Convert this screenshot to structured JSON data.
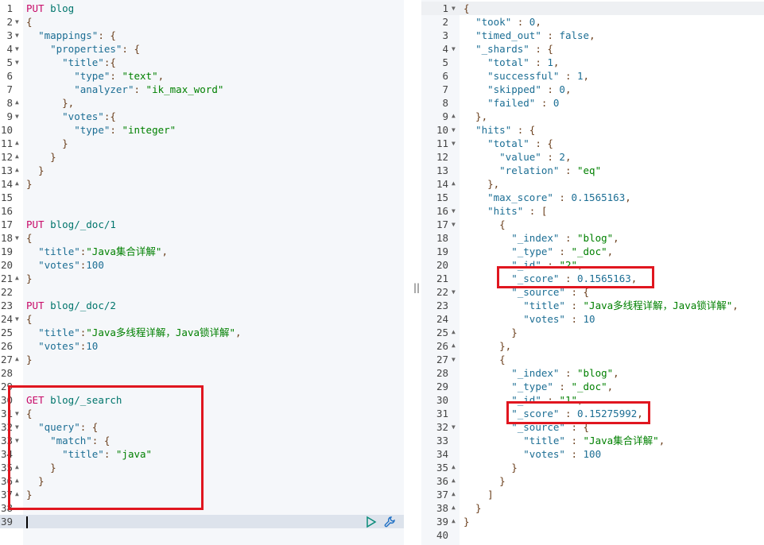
{
  "request_editor": {
    "active_line": 39,
    "actions": {
      "run": "play-icon",
      "settings": "wrench-icon"
    },
    "lines": [
      [
        "",
        [
          [
            "m",
            "PUT"
          ],
          [
            "p",
            " "
          ],
          [
            "u",
            "blog"
          ]
        ]
      ],
      [
        "open",
        [
          [
            "p",
            "{"
          ]
        ]
      ],
      [
        "open",
        [
          [
            "p",
            "  "
          ],
          [
            "k",
            "\"mappings\""
          ],
          [
            "p",
            ": {"
          ]
        ]
      ],
      [
        "open",
        [
          [
            "p",
            "    "
          ],
          [
            "k",
            "\"properties\""
          ],
          [
            "p",
            ": {"
          ]
        ]
      ],
      [
        "open",
        [
          [
            "p",
            "      "
          ],
          [
            "k",
            "\"title\""
          ],
          [
            "p",
            ":{"
          ]
        ]
      ],
      [
        "",
        [
          [
            "p",
            "        "
          ],
          [
            "k",
            "\"type\""
          ],
          [
            "p",
            ": "
          ],
          [
            "s",
            "\"text\""
          ],
          [
            "p",
            ","
          ]
        ]
      ],
      [
        "",
        [
          [
            "p",
            "        "
          ],
          [
            "k",
            "\"analyzer\""
          ],
          [
            "p",
            ": "
          ],
          [
            "s",
            "\"ik_max_word\""
          ]
        ]
      ],
      [
        "close",
        [
          [
            "p",
            "      },"
          ]
        ]
      ],
      [
        "open",
        [
          [
            "p",
            "      "
          ],
          [
            "k",
            "\"votes\""
          ],
          [
            "p",
            ":{"
          ]
        ]
      ],
      [
        "",
        [
          [
            "p",
            "        "
          ],
          [
            "k",
            "\"type\""
          ],
          [
            "p",
            ": "
          ],
          [
            "s",
            "\"integer\""
          ]
        ]
      ],
      [
        "close",
        [
          [
            "p",
            "      }"
          ]
        ]
      ],
      [
        "close",
        [
          [
            "p",
            "    }"
          ]
        ]
      ],
      [
        "close",
        [
          [
            "p",
            "  }"
          ]
        ]
      ],
      [
        "close",
        [
          [
            "p",
            "}"
          ]
        ]
      ],
      [
        "",
        []
      ],
      [
        "",
        []
      ],
      [
        "",
        [
          [
            "m",
            "PUT"
          ],
          [
            "p",
            " "
          ],
          [
            "u",
            "blog/_doc/1"
          ]
        ]
      ],
      [
        "open",
        [
          [
            "p",
            "{"
          ]
        ]
      ],
      [
        "",
        [
          [
            "p",
            "  "
          ],
          [
            "k",
            "\"title\""
          ],
          [
            "p",
            ":"
          ],
          [
            "s",
            "\"Java集合详解\""
          ],
          [
            "p",
            ","
          ]
        ]
      ],
      [
        "",
        [
          [
            "p",
            "  "
          ],
          [
            "k",
            "\"votes\""
          ],
          [
            "p",
            ":"
          ],
          [
            "n",
            "100"
          ]
        ]
      ],
      [
        "close",
        [
          [
            "p",
            "}"
          ]
        ]
      ],
      [
        "",
        []
      ],
      [
        "",
        [
          [
            "m",
            "PUT"
          ],
          [
            "p",
            " "
          ],
          [
            "u",
            "blog/_doc/2"
          ]
        ]
      ],
      [
        "open",
        [
          [
            "p",
            "{"
          ]
        ]
      ],
      [
        "",
        [
          [
            "p",
            "  "
          ],
          [
            "k",
            "\"title\""
          ],
          [
            "p",
            ":"
          ],
          [
            "s",
            "\"Java多线程详解，Java锁详解\""
          ],
          [
            "p",
            ","
          ]
        ]
      ],
      [
        "",
        [
          [
            "p",
            "  "
          ],
          [
            "k",
            "\"votes\""
          ],
          [
            "p",
            ":"
          ],
          [
            "n",
            "10"
          ]
        ]
      ],
      [
        "close",
        [
          [
            "p",
            "}"
          ]
        ]
      ],
      [
        "",
        []
      ],
      [
        "",
        []
      ],
      [
        "",
        [
          [
            "m",
            "GET"
          ],
          [
            "p",
            " "
          ],
          [
            "u",
            "blog/_search"
          ]
        ]
      ],
      [
        "open",
        [
          [
            "p",
            "{"
          ]
        ]
      ],
      [
        "open",
        [
          [
            "p",
            "  "
          ],
          [
            "k",
            "\"query\""
          ],
          [
            "p",
            ": {"
          ]
        ]
      ],
      [
        "open",
        [
          [
            "p",
            "    "
          ],
          [
            "k",
            "\"match\""
          ],
          [
            "p",
            ": {"
          ]
        ]
      ],
      [
        "",
        [
          [
            "p",
            "      "
          ],
          [
            "k",
            "\"title\""
          ],
          [
            "p",
            ": "
          ],
          [
            "s",
            "\"java\""
          ]
        ]
      ],
      [
        "close",
        [
          [
            "p",
            "    }"
          ]
        ]
      ],
      [
        "close",
        [
          [
            "p",
            "  }"
          ]
        ]
      ],
      [
        "close",
        [
          [
            "p",
            "}"
          ]
        ]
      ],
      [
        "",
        []
      ],
      [
        "",
        []
      ]
    ]
  },
  "response_viewer": {
    "active_line": 1,
    "lines": [
      [
        "open",
        [
          [
            "p",
            "{"
          ]
        ]
      ],
      [
        "",
        [
          [
            "p",
            "  "
          ],
          [
            "k",
            "\"took\""
          ],
          [
            "p",
            " : "
          ],
          [
            "n",
            "0"
          ],
          [
            "p",
            ","
          ]
        ]
      ],
      [
        "",
        [
          [
            "p",
            "  "
          ],
          [
            "k",
            "\"timed_out\""
          ],
          [
            "p",
            " : "
          ],
          [
            "b",
            "false"
          ],
          [
            "p",
            ","
          ]
        ]
      ],
      [
        "open",
        [
          [
            "p",
            "  "
          ],
          [
            "k",
            "\"_shards\""
          ],
          [
            "p",
            " : {"
          ]
        ]
      ],
      [
        "",
        [
          [
            "p",
            "    "
          ],
          [
            "k",
            "\"total\""
          ],
          [
            "p",
            " : "
          ],
          [
            "n",
            "1"
          ],
          [
            "p",
            ","
          ]
        ]
      ],
      [
        "",
        [
          [
            "p",
            "    "
          ],
          [
            "k",
            "\"successful\""
          ],
          [
            "p",
            " : "
          ],
          [
            "n",
            "1"
          ],
          [
            "p",
            ","
          ]
        ]
      ],
      [
        "",
        [
          [
            "p",
            "    "
          ],
          [
            "k",
            "\"skipped\""
          ],
          [
            "p",
            " : "
          ],
          [
            "n",
            "0"
          ],
          [
            "p",
            ","
          ]
        ]
      ],
      [
        "",
        [
          [
            "p",
            "    "
          ],
          [
            "k",
            "\"failed\""
          ],
          [
            "p",
            " : "
          ],
          [
            "n",
            "0"
          ]
        ]
      ],
      [
        "close",
        [
          [
            "p",
            "  },"
          ]
        ]
      ],
      [
        "open",
        [
          [
            "p",
            "  "
          ],
          [
            "k",
            "\"hits\""
          ],
          [
            "p",
            " : {"
          ]
        ]
      ],
      [
        "open",
        [
          [
            "p",
            "    "
          ],
          [
            "k",
            "\"total\""
          ],
          [
            "p",
            " : {"
          ]
        ]
      ],
      [
        "",
        [
          [
            "p",
            "      "
          ],
          [
            "k",
            "\"value\""
          ],
          [
            "p",
            " : "
          ],
          [
            "n",
            "2"
          ],
          [
            "p",
            ","
          ]
        ]
      ],
      [
        "",
        [
          [
            "p",
            "      "
          ],
          [
            "k",
            "\"relation\""
          ],
          [
            "p",
            " : "
          ],
          [
            "s",
            "\"eq\""
          ]
        ]
      ],
      [
        "close",
        [
          [
            "p",
            "    },"
          ]
        ]
      ],
      [
        "",
        [
          [
            "p",
            "    "
          ],
          [
            "k",
            "\"max_score\""
          ],
          [
            "p",
            " : "
          ],
          [
            "n",
            "0.1565163"
          ],
          [
            "p",
            ","
          ]
        ]
      ],
      [
        "open",
        [
          [
            "p",
            "    "
          ],
          [
            "k",
            "\"hits\""
          ],
          [
            "p",
            " : ["
          ]
        ]
      ],
      [
        "open",
        [
          [
            "p",
            "      {"
          ]
        ]
      ],
      [
        "",
        [
          [
            "p",
            "        "
          ],
          [
            "k",
            "\"_index\""
          ],
          [
            "p",
            " : "
          ],
          [
            "s",
            "\"blog\""
          ],
          [
            "p",
            ","
          ]
        ]
      ],
      [
        "",
        [
          [
            "p",
            "        "
          ],
          [
            "k",
            "\"_type\""
          ],
          [
            "p",
            " : "
          ],
          [
            "s",
            "\"_doc\""
          ],
          [
            "p",
            ","
          ]
        ]
      ],
      [
        "",
        [
          [
            "p",
            "        "
          ],
          [
            "k",
            "\"_id\""
          ],
          [
            "p",
            " : "
          ],
          [
            "s",
            "\"2\""
          ],
          [
            "p",
            ","
          ]
        ]
      ],
      [
        "",
        [
          [
            "p",
            "        "
          ],
          [
            "k",
            "\"_score\""
          ],
          [
            "p",
            " : "
          ],
          [
            "n",
            "0.1565163"
          ],
          [
            "p",
            ","
          ]
        ]
      ],
      [
        "open",
        [
          [
            "p",
            "        "
          ],
          [
            "k",
            "\"_source\""
          ],
          [
            "p",
            " : {"
          ]
        ]
      ],
      [
        "",
        [
          [
            "p",
            "          "
          ],
          [
            "k",
            "\"title\""
          ],
          [
            "p",
            " : "
          ],
          [
            "s",
            "\"Java多线程详解，Java锁详解\""
          ],
          [
            "p",
            ","
          ]
        ]
      ],
      [
        "",
        [
          [
            "p",
            "          "
          ],
          [
            "k",
            "\"votes\""
          ],
          [
            "p",
            " : "
          ],
          [
            "n",
            "10"
          ]
        ]
      ],
      [
        "close",
        [
          [
            "p",
            "        }"
          ]
        ]
      ],
      [
        "close",
        [
          [
            "p",
            "      },"
          ]
        ]
      ],
      [
        "open",
        [
          [
            "p",
            "      {"
          ]
        ]
      ],
      [
        "",
        [
          [
            "p",
            "        "
          ],
          [
            "k",
            "\"_index\""
          ],
          [
            "p",
            " : "
          ],
          [
            "s",
            "\"blog\""
          ],
          [
            "p",
            ","
          ]
        ]
      ],
      [
        "",
        [
          [
            "p",
            "        "
          ],
          [
            "k",
            "\"_type\""
          ],
          [
            "p",
            " : "
          ],
          [
            "s",
            "\"_doc\""
          ],
          [
            "p",
            ","
          ]
        ]
      ],
      [
        "",
        [
          [
            "p",
            "        "
          ],
          [
            "k",
            "\"_id\""
          ],
          [
            "p",
            " : "
          ],
          [
            "s",
            "\"1\""
          ],
          [
            "p",
            ","
          ]
        ]
      ],
      [
        "",
        [
          [
            "p",
            "        "
          ],
          [
            "k",
            "\"_score\""
          ],
          [
            "p",
            " : "
          ],
          [
            "n",
            "0.15275992"
          ],
          [
            "p",
            ","
          ]
        ]
      ],
      [
        "open",
        [
          [
            "p",
            "        "
          ],
          [
            "k",
            "\"_source\""
          ],
          [
            "p",
            " : {"
          ]
        ]
      ],
      [
        "",
        [
          [
            "p",
            "          "
          ],
          [
            "k",
            "\"title\""
          ],
          [
            "p",
            " : "
          ],
          [
            "s",
            "\"Java集合详解\""
          ],
          [
            "p",
            ","
          ]
        ]
      ],
      [
        "",
        [
          [
            "p",
            "          "
          ],
          [
            "k",
            "\"votes\""
          ],
          [
            "p",
            " : "
          ],
          [
            "n",
            "100"
          ]
        ]
      ],
      [
        "close",
        [
          [
            "p",
            "        }"
          ]
        ]
      ],
      [
        "close",
        [
          [
            "p",
            "      }"
          ]
        ]
      ],
      [
        "close",
        [
          [
            "p",
            "    ]"
          ]
        ]
      ],
      [
        "close",
        [
          [
            "p",
            "  }"
          ]
        ]
      ],
      [
        "close",
        [
          [
            "p",
            "}"
          ]
        ]
      ],
      [
        "",
        []
      ]
    ]
  },
  "divider_handle": "||",
  "highlight_color": "#e0161f"
}
